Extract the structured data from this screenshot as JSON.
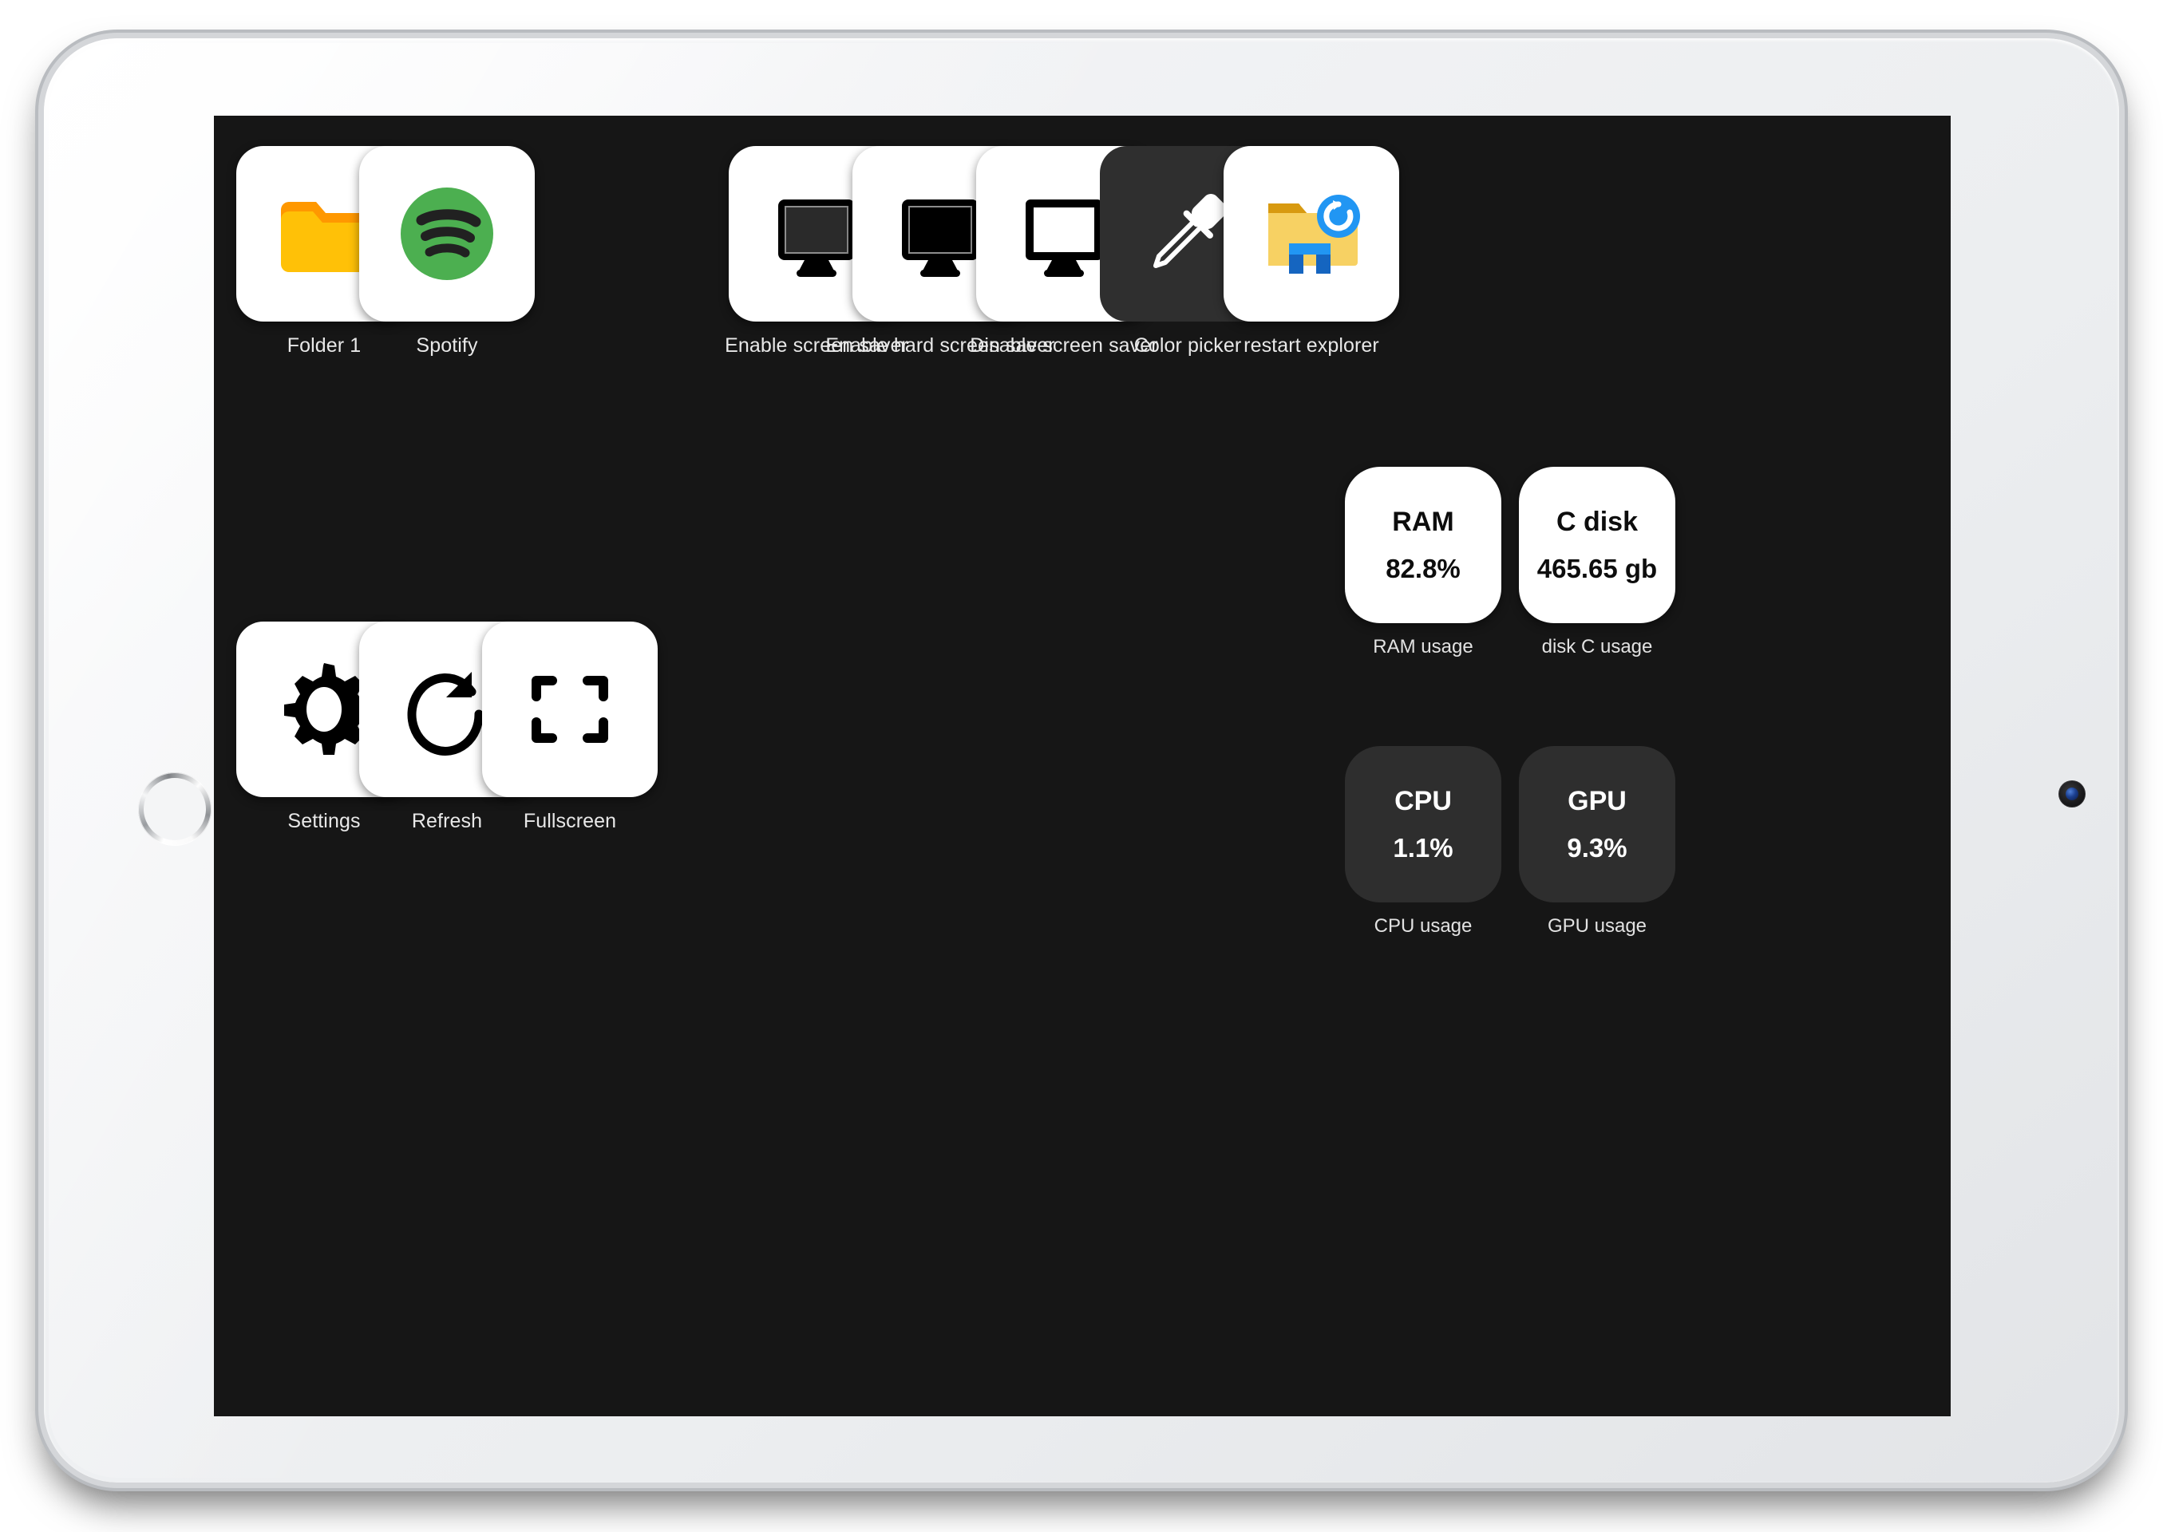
{
  "device": {
    "type": "tablet",
    "home_button": "home-button",
    "camera": "front-camera"
  },
  "screen": {
    "background_color": "#161616",
    "tile_color": "#ffffff",
    "dark_tile_color": "#2f2f2f",
    "label_color": "#e8e8e8"
  },
  "shortcuts_left": [
    {
      "label": "Folder 1",
      "icon": "folder-icon",
      "tile": "light"
    },
    {
      "label": "Spotify",
      "icon": "spotify-icon",
      "tile": "light"
    }
  ],
  "shortcuts_right": [
    {
      "label": "Enable screen saver",
      "icon": "monitor-dim-icon",
      "tile": "light"
    },
    {
      "label": "Enable hard screen saver",
      "icon": "monitor-black-icon",
      "tile": "light"
    },
    {
      "label": "Disable screen saver",
      "icon": "monitor-outline-icon",
      "tile": "light"
    },
    {
      "label": "Color picker",
      "icon": "eyedropper-icon",
      "tile": "dark"
    },
    {
      "label": "restart explorer",
      "icon": "explorer-restart-icon",
      "tile": "light"
    }
  ],
  "controls_bottom": [
    {
      "label": "Settings",
      "icon": "gear-icon",
      "tile": "light"
    },
    {
      "label": "Refresh",
      "icon": "refresh-icon",
      "tile": "light"
    },
    {
      "label": "Fullscreen",
      "icon": "fullscreen-icon",
      "tile": "light"
    }
  ],
  "widgets": [
    {
      "title": "RAM",
      "value": "82.8%",
      "label": "RAM usage",
      "style": "light"
    },
    {
      "title": "C disk",
      "value": "465.65 gb",
      "label": "disk C usage",
      "style": "light"
    },
    {
      "title": "CPU",
      "value": "1.1%",
      "label": "CPU usage",
      "style": "dark"
    },
    {
      "title": "GPU",
      "value": "9.3%",
      "label": "GPU usage",
      "style": "dark"
    }
  ],
  "colors": {
    "folder_yellow": "#ffc107",
    "folder_orange": "#ff9800",
    "spotify_green": "#4caf50",
    "explorer_blue": "#2196f3",
    "explorer_yellow": "#f7d163"
  }
}
